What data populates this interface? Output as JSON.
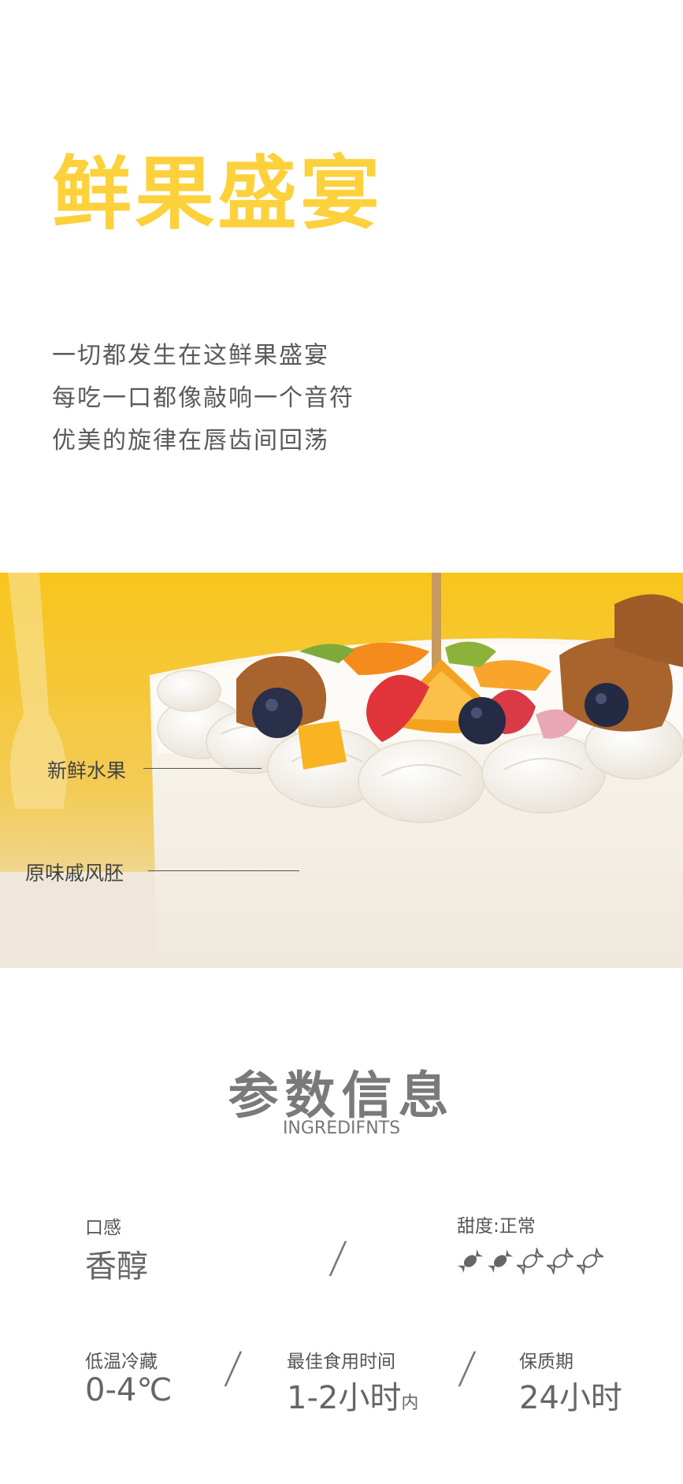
{
  "title": "鲜果盛宴",
  "poem": [
    "一切都发生在这鲜果盛宴",
    "每吃一口都像敲响一个音符",
    "优美的旋律在唇齿间回荡"
  ],
  "photo": {
    "callouts": [
      "新鲜水果",
      "原味戚风胚"
    ],
    "background_color": "#F8C51A"
  },
  "params": {
    "title": "参数信息",
    "subtitle": "INGREDIFNTS",
    "taste_label": "口感",
    "taste_value": "香醇",
    "sweetness_label": "甜度:正常",
    "sweetness_level": 2,
    "sweetness_max": 5,
    "storage_label": "低温冷藏",
    "storage_value": "0-4℃",
    "best_label": "最佳食用时间",
    "best_value": "1-2小时",
    "best_suffix": "内",
    "shelf_label": "保质期",
    "shelf_value": "24小时",
    "slash": "/"
  }
}
